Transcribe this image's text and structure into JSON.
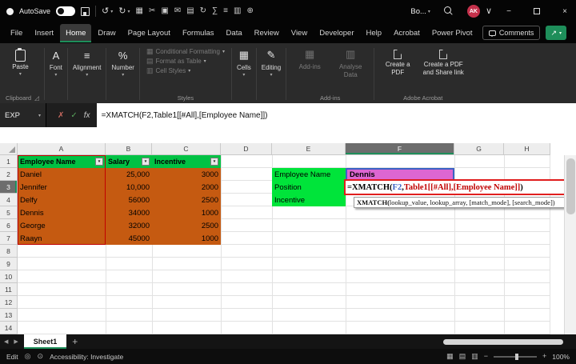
{
  "title_bar": {
    "autosave_label": "AutoSave",
    "workbook_title": "Bo...",
    "avatar_initials": "AK",
    "qat_icons": [
      {
        "name": "table-icon",
        "glyph": "▦"
      },
      {
        "name": "cut-icon",
        "glyph": "✂"
      },
      {
        "name": "copy-icon",
        "glyph": "▣"
      },
      {
        "name": "email-icon",
        "glyph": "✉"
      },
      {
        "name": "print-icon",
        "glyph": "▤"
      },
      {
        "name": "refresh-icon",
        "glyph": "↻"
      },
      {
        "name": "sum-icon",
        "glyph": "∑"
      },
      {
        "name": "sort-icon",
        "glyph": "≡"
      },
      {
        "name": "chart-icon",
        "glyph": "▥"
      },
      {
        "name": "add-icon",
        "glyph": "⊕"
      }
    ]
  },
  "icons": {
    "caret": "▾",
    "undo": "↺",
    "redo": "↻",
    "cancel": "✗",
    "check": "✓",
    "fx": "fx",
    "minimize": "−",
    "close": "×",
    "chevron_down": "∨",
    "left_arrow": "◀",
    "right_arrow": "▶",
    "plus": "+",
    "minus": "−",
    "percent": "%",
    "font_a": "A",
    "align": "≡",
    "grid": "▦",
    "grid2": "▤",
    "grid3": "▥",
    "pencil": "✎",
    "launcher": "◿",
    "share": "↗",
    "macro": "◎",
    "accessibility": "⊙"
  },
  "menu_bar": {
    "tabs": [
      "File",
      "Insert",
      "Home",
      "Draw",
      "Page Layout",
      "Formulas",
      "Data",
      "Review",
      "View",
      "Developer",
      "Help",
      "Acrobat",
      "Power Pivot"
    ],
    "active_tab": "Home",
    "comments_label": "Comments"
  },
  "ribbon": {
    "paste_label": "Paste",
    "font_label": "Font",
    "alignment_label": "Alignment",
    "number_label": "Number",
    "styles_items": [
      "Conditional Formatting",
      "Format as Table",
      "Cell Styles"
    ],
    "cells_label": "Cells",
    "editing_label": "Editing",
    "addins_button_label": "Add-ins",
    "analyse_data_label": "Analyse Data",
    "create_pdf_label": "Create a PDF",
    "create_pdf_share_label": "Create a PDF and Share link",
    "group_labels": {
      "clipboard": "Clipboard",
      "styles": "Styles",
      "addins": "Add-ins",
      "acrobat": "Adobe Acrobat"
    }
  },
  "formula_bar": {
    "name_box_value": "EXP",
    "formula_full": "=XMATCH(F2,Table1[[#All],[Employee Name]])"
  },
  "grid": {
    "column_headers": [
      "A",
      "B",
      "C",
      "D",
      "E",
      "F",
      "G",
      "H"
    ],
    "row_headers": [
      "1",
      "2",
      "3",
      "4",
      "5",
      "6",
      "7",
      "8",
      "9",
      "10",
      "11",
      "12",
      "13",
      "14"
    ],
    "selected_column": "F",
    "table_headers": [
      "Employee Name",
      "Salary",
      "Incentive"
    ],
    "table_rows": [
      [
        "Daniel",
        "25,000",
        "3000"
      ],
      [
        "Jennifer",
        "10,000",
        "2000"
      ],
      [
        "Delfy",
        "56000",
        "2500"
      ],
      [
        "Dennis",
        "34000",
        "1000"
      ],
      [
        "George",
        "32000",
        "2500"
      ],
      [
        "Raayn",
        "45000",
        "1000"
      ]
    ],
    "lookup_labels": [
      "Employee Name",
      "Position",
      "Incentive"
    ],
    "lookup_value": "Dennis",
    "cell_formula": {
      "p1": "=XMATCH(",
      "p2": "F2",
      "p3": ",",
      "p4": "Table1[[#All],[Employee Name]]",
      "p5": ")"
    },
    "tooltip": {
      "fn": "XMATCH(",
      "args": "lookup_value, lookup_array, [match_mode], [search_mode])"
    }
  },
  "sheet_bar": {
    "tab_label": "Sheet1"
  },
  "status_bar": {
    "mode": "Edit",
    "accessibility": "Accessibility: Investigate",
    "zoom": "100%"
  },
  "colors": {
    "header_green": "#00C244",
    "label_green": "#00E43A",
    "data_orange": "#C55A11",
    "value_magenta": "#DD66D2",
    "ref_blue": "#3B62C4",
    "ref_red": "#C00000",
    "focus_red": "#E01E1E",
    "accent_green": "#1E8E5A"
  }
}
